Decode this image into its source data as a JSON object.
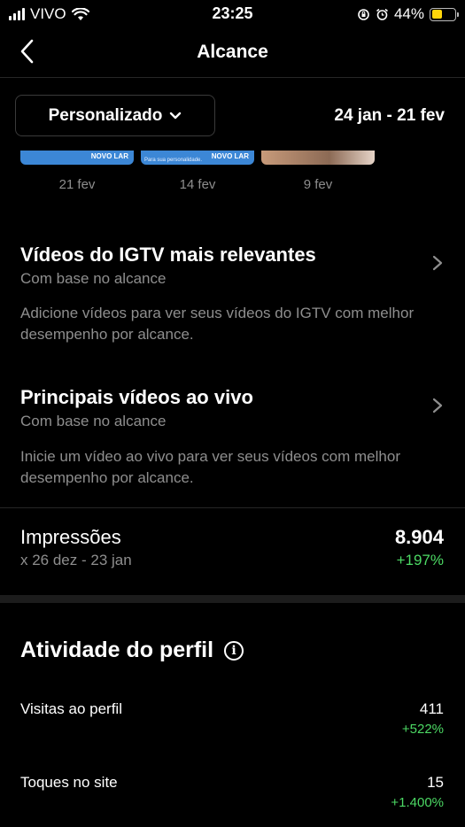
{
  "status_bar": {
    "carrier": "VIVO",
    "time": "23:25",
    "battery": "44%",
    "battery_level": 0.44
  },
  "nav": {
    "title": "Alcance"
  },
  "filter": {
    "dropdown_label": "Personalizado",
    "date_range": "24 jan - 21 fev"
  },
  "thumbnails": [
    {
      "date": "21 fev",
      "tag": "NOVO LAR",
      "style": "blue"
    },
    {
      "date": "14 fev",
      "tag": "NOVO LAR",
      "caption": "Para sua personalidade.",
      "style": "blue"
    },
    {
      "date": "9 fev",
      "style": "tan"
    }
  ],
  "igtv": {
    "title": "Vídeos do IGTV mais relevantes",
    "subtitle": "Com base no alcance",
    "body": "Adicione vídeos para ver seus vídeos do IGTV com melhor desempenho por alcance."
  },
  "live": {
    "title": "Principais vídeos ao vivo",
    "subtitle": "Com base no alcance",
    "body": "Inicie um vídeo ao vivo para ver seus vídeos com melhor desempenho por alcance."
  },
  "impressions": {
    "title": "Impressões",
    "comparison": "x 26 dez - 23 jan",
    "value": "8.904",
    "change": "+197%"
  },
  "profile_activity": {
    "title": "Atividade do perfil",
    "metrics": [
      {
        "label": "Visitas ao perfil",
        "value": "411",
        "change": "+522%"
      },
      {
        "label": "Toques no site",
        "value": "15",
        "change": "+1.400%"
      }
    ]
  },
  "colors": {
    "background": "#000000",
    "positive": "#4cd964",
    "muted_text": "#8e8e8e",
    "battery": "#ffd60a"
  }
}
